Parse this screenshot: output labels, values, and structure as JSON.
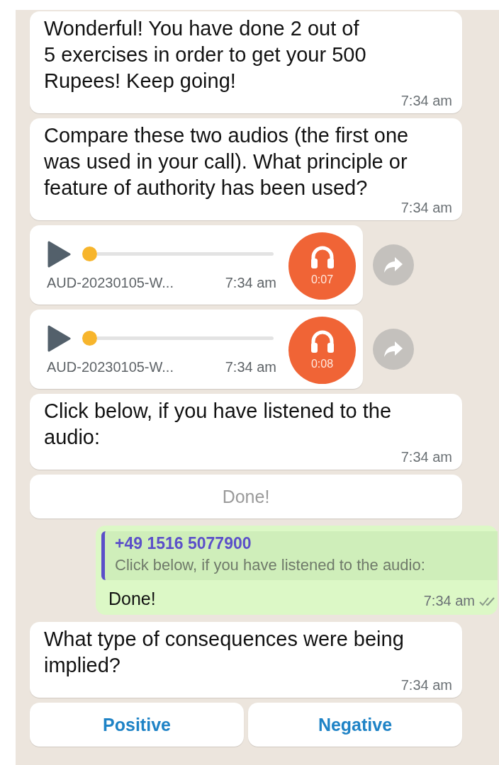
{
  "messages": [
    {
      "kind": "text",
      "text": "Wonderful! You have done 2 out of\n5 exercises in order to get your 500 Rupees! Keep going!",
      "time": "7:34 am"
    },
    {
      "kind": "text",
      "text": "Compare these two audios (the first one was used in your call). What principle or feature of authority has been used?",
      "time": "7:34 am"
    },
    {
      "kind": "audio",
      "file": "AUD-20230105-W...",
      "time": "7:34 am",
      "duration": "0:07",
      "level": 0
    },
    {
      "kind": "audio",
      "file": "AUD-20230105-W...",
      "time": "7:34 am",
      "duration": "0:08",
      "level": 0
    },
    {
      "kind": "text",
      "text": "Click below, if you have listened to the audio:",
      "time": "7:34 am"
    },
    {
      "kind": "buttons",
      "buttons": [
        {
          "label": "Done!",
          "disabled": true
        }
      ]
    },
    {
      "kind": "reply",
      "quote_author": "+49 1516 5077900",
      "quote_text": "Click below, if you have listened to the audio:",
      "text": "Done!",
      "time": "7:34 am"
    },
    {
      "kind": "text",
      "text": "What type of consequences were being implied?",
      "time": "7:34 am"
    },
    {
      "kind": "buttons",
      "buttons": [
        {
          "label": "Positive",
          "disabled": false
        },
        {
          "label": "Negative",
          "disabled": false
        }
      ]
    }
  ]
}
